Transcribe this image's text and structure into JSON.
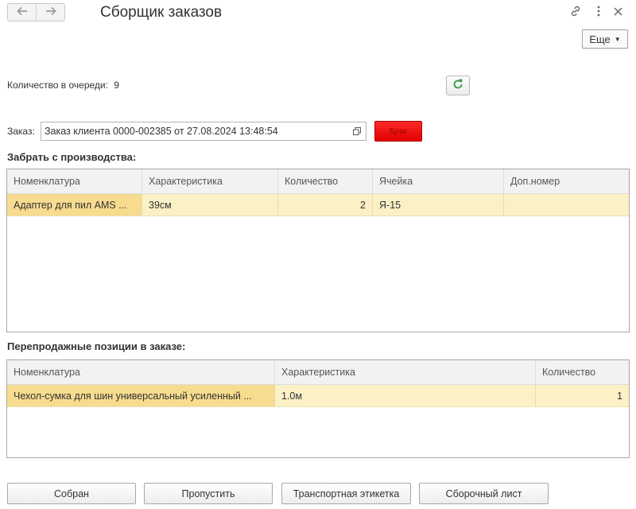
{
  "header": {
    "title": "Сборщик заказов",
    "more_label": "Еще"
  },
  "queue": {
    "label": "Количество в очереди:",
    "count": "9"
  },
  "order": {
    "label": "Заказ:",
    "value": "Заказ клиента 0000-002385 от 27.08.2024 13:48:54",
    "red_button_label": "Брак"
  },
  "production": {
    "title": "Забрать с производства:",
    "columns": [
      "Номенклатура",
      "Характеристика",
      "Количество",
      "Ячейка",
      "Доп.номер"
    ],
    "rows": [
      [
        "Адаптер для пил AMS ...",
        "39см",
        "2",
        "Я-15",
        ""
      ]
    ]
  },
  "resale": {
    "title": "Перепродажные позиции в заказе:",
    "columns": [
      "Номенклатура",
      "Характеристика",
      "Количество"
    ],
    "rows": [
      [
        "Чехол-сумка для шин универсальный усиленный ...",
        "1.0м",
        "1"
      ]
    ]
  },
  "buttons": {
    "assembled": "Собран",
    "skip": "Пропустить",
    "transport_label": "Транспортная этикетка",
    "assembly_sheet": "Сборочный лист"
  },
  "colors": {
    "selected_row": "#fbf0c6",
    "selected_cell": "#f7db8e",
    "red_button": "#f00000",
    "refresh_icon": "#2e9c3a"
  },
  "icons": [
    "arrow-left-icon",
    "arrow-right-icon",
    "link-icon",
    "more-vertical-icon",
    "close-icon",
    "refresh-icon",
    "open-form-icon"
  ]
}
